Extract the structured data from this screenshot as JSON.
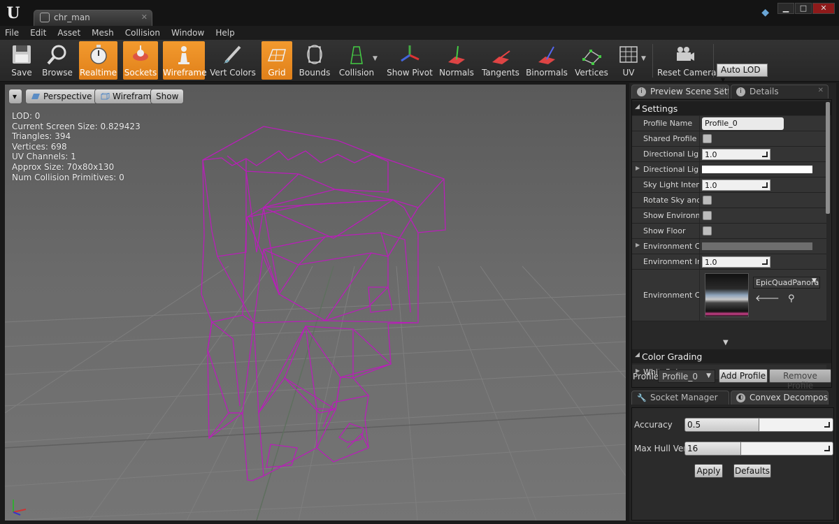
{
  "window": {
    "doc_tab": "chr_man",
    "buttons": {
      "minimize": "▁",
      "restore": "□",
      "close": "✕"
    }
  },
  "menu": [
    "File",
    "Edit",
    "Asset",
    "Mesh",
    "Collision",
    "Window",
    "Help"
  ],
  "toolbar": {
    "save": "Save",
    "browse": "Browse",
    "realtime": "Realtime",
    "sockets": "Sockets",
    "wireframe": "Wireframe",
    "vert_colors": "Vert Colors",
    "grid": "Grid",
    "bounds": "Bounds",
    "collision": "Collision",
    "show_pivot": "Show Pivot",
    "normals": "Normals",
    "tangents": "Tangents",
    "binormals": "Binormals",
    "vertices": "Vertices",
    "uv": "UV",
    "reset_camera": "Reset Camera",
    "auto_lod": "Auto LOD",
    "active_color": "#f0922a"
  },
  "viewport": {
    "perspective": "Perspective",
    "wireframe": "Wireframe",
    "show": "Show",
    "stats": [
      "LOD:  0",
      "Current Screen Size:  0.829423",
      "Triangles:  394",
      "Vertices:  698",
      "UV Channels:  1",
      "Approx Size: 70x80x130",
      "Num Collision Primitives:  0"
    ],
    "wire_color": "#b81fb8",
    "background_color": "#6a6a6a"
  },
  "details_panel": {
    "tab_preview": "Preview Scene Setti",
    "tab_details": "Details",
    "settings_header": "Settings",
    "profile_name_label": "Profile Name",
    "profile_name_value": "Profile_0",
    "shared_profile_label": "Shared Profile",
    "dir_light_intensity_label": "Directional Light",
    "dir_light_intensity_value": "1.0",
    "dir_light_color_label": "Directional Light",
    "sky_light_label": "Sky Light Intensi",
    "sky_light_value": "1.0",
    "rotate_sky_label": "Rotate Sky and D",
    "show_env_label": "Show Environmer",
    "show_floor_label": "Show Floor",
    "env_color_label": "Environment Col",
    "env_intensity_label": "Environment Inte",
    "env_intensity_value": "1.0",
    "env_cube_label": "Environment Cub",
    "env_cube_asset": "EpicQuadPanorar",
    "color_grading_header": "Color Grading",
    "white_balance_label": "WhiteBalance",
    "profile_label": "Profile",
    "profile_combo": "Profile_0",
    "add_profile": "Add Profile",
    "remove_profile": "Remove Profile"
  },
  "convex_panel": {
    "tab_socket": "Socket Manager",
    "tab_convex": "Convex Decompos",
    "accuracy_label": "Accuracy",
    "accuracy_value": "0.5",
    "accuracy_fraction": 0.5,
    "max_hull_label": "Max Hull Verts",
    "max_hull_value": "16",
    "max_hull_fraction": 0.38,
    "apply": "Apply",
    "defaults": "Defaults"
  }
}
